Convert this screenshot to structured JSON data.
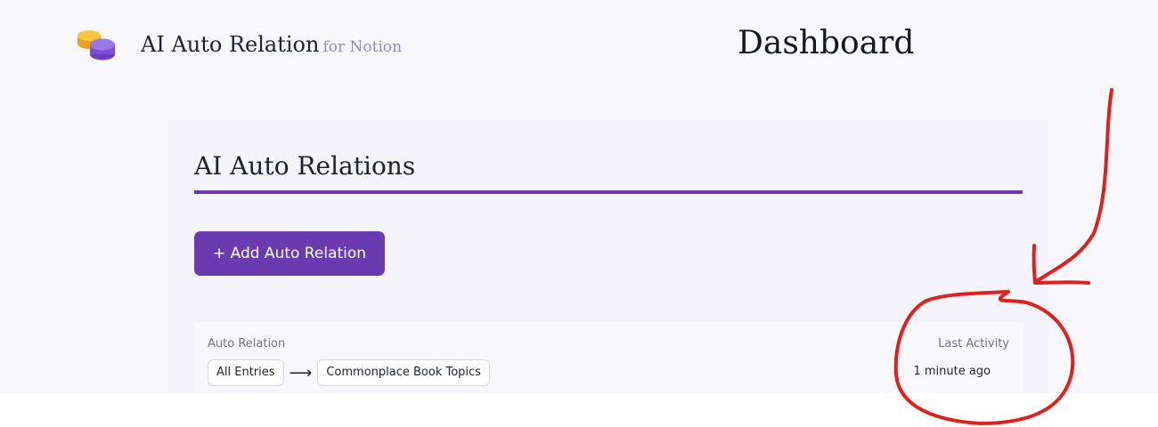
{
  "header": {
    "brand_name": "AI Auto Relation",
    "brand_suffix": "for Notion",
    "page_title": "Dashboard"
  },
  "main": {
    "section_title": "AI Auto Relations",
    "add_button_label": "+ Add Auto Relation",
    "table": {
      "columns": [
        "Auto Relation",
        "Last Activity"
      ],
      "rows": [
        {
          "source": "All Entries",
          "arrow": "⟶",
          "target": "Commonplace Book Topics",
          "last_activity": "1 minute ago"
        }
      ]
    }
  },
  "colors": {
    "accent": "#6a3ab0",
    "brand_suffix": "#8f86e0",
    "annotation": "#e0201c"
  },
  "icons": {
    "logo": "stacked-coins-icon",
    "annotation": "hand-drawn-arrow-and-circle"
  }
}
